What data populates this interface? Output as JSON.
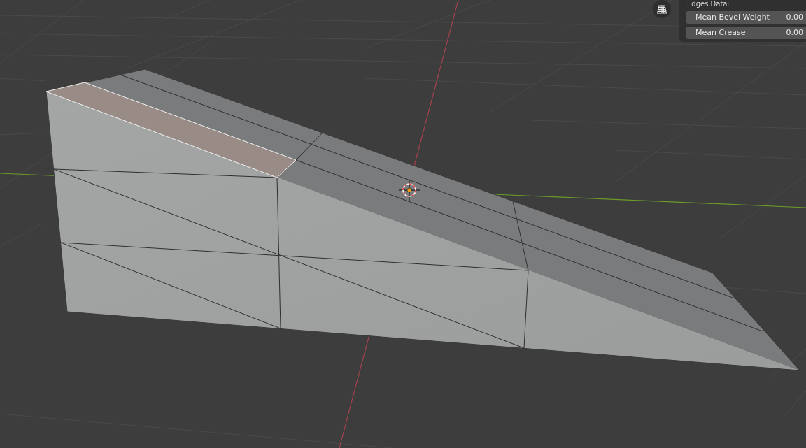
{
  "viewport": {
    "sidebar": {
      "section_title": "Edges Data:",
      "fields": [
        {
          "label": "Mean Bevel Weight",
          "value": "0.00"
        },
        {
          "label": "Mean Crease",
          "value": "0.00"
        }
      ]
    }
  }
}
